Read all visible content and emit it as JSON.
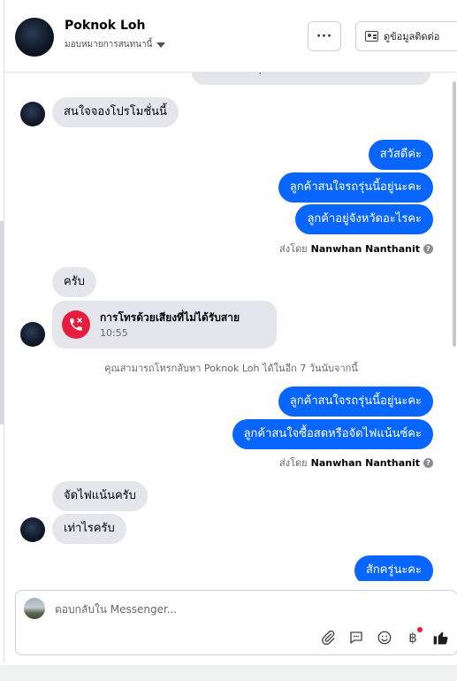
{
  "header": {
    "name": "Poknok Loh",
    "subtitle": "มอบหมายการสนทนานี้",
    "more_label": "···",
    "contact_label": "ดูข้อมูลติดต่อ"
  },
  "thread": {
    "cut_message": "ขอบคุณที่สนใจโปรโมชั่นของเรา",
    "messages_a": [
      {
        "text": "สนใจจองโปรโมชั่นนี้"
      },
      {
        "text": "สวัสดีค่ะ"
      },
      {
        "text": "ลูกค้าสนใจรถรุ่นนี้อยู่นะคะ"
      },
      {
        "text": "ลูกค้าอยู่จังหวัดอะไรคะ"
      }
    ],
    "sent_by_prefix": "ส่งโดย",
    "sent_by_name": "Nanwhan Nanthanit",
    "reply_1": "ครับ",
    "missed_call": {
      "title": "การโทรด้วยเสียงที่ไม่ได้รับสาย",
      "time": "10:55"
    },
    "callback_note": "คุณสามารถโทรกลับหา Poknok Loh ได้ในอีก 7 วันนับจากนี้",
    "messages_b": [
      {
        "text": "ลูกค้าสนใจรถรุ่นนี้อยู่นะคะ"
      },
      {
        "text": "ลูกค้าสนใจซื้อสดหรือจัดไฟแน้นซ์คะ"
      }
    ],
    "messages_c": [
      {
        "text": "จัดไฟแน้นครับ"
      },
      {
        "text": "เท่าไรครับ"
      },
      {
        "text": "สักครู่นะคะ"
      }
    ]
  },
  "composer": {
    "placeholder": "ตอบกลับใน Messenger..."
  },
  "colors": {
    "outgoing": "#0866ff",
    "incoming": "#e4e6eb",
    "missed_call": "#e41e3f"
  },
  "icons": [
    "chevron-down-icon",
    "contact-card-icon",
    "missed-call-icon",
    "help-icon",
    "attach-icon",
    "saved-reply-icon",
    "emoji-icon",
    "baht-payment-icon",
    "like-icon"
  ]
}
